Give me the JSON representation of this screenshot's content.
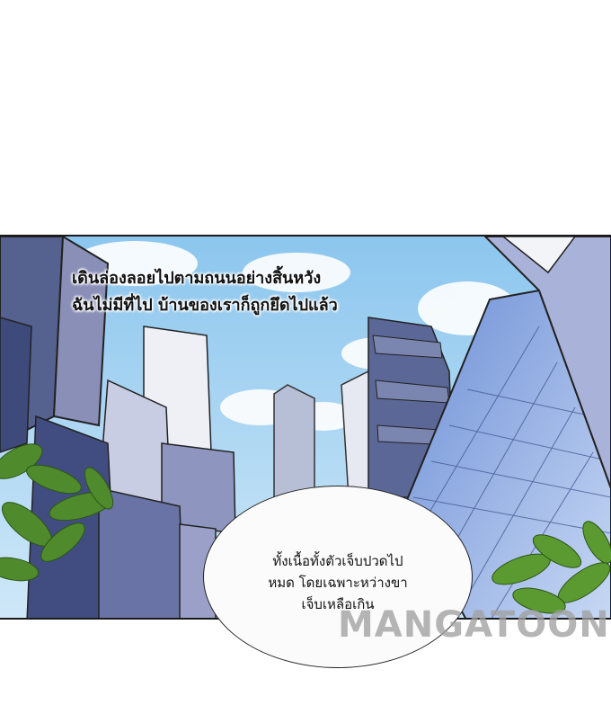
{
  "narration": {
    "line1": "เดินล่องลอยไปตามถนนอย่างสิ้นหวัง",
    "line2": "ฉันไม่มีที่ไป บ้านของเราก็ถูกยึดไปแล้ว"
  },
  "bubble": {
    "line1": "ทั้งเนื้อทั้งตัวเจ็บปวดไป",
    "line2": "หมด โดยเฉพาะหว่างขา",
    "line3": "เจ็บเหลือเกิน"
  },
  "watermark": {
    "text": "MANGATOON"
  },
  "colors": {
    "sky": "#9fd0f0",
    "building_dark": "#3c4a7a",
    "building_light": "#d8dcee",
    "leaves": "#4f8a2c"
  }
}
